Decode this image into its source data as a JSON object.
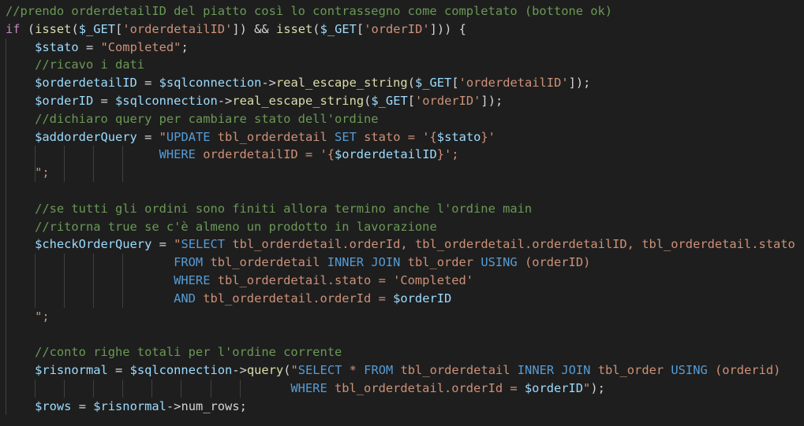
{
  "editor": {
    "language": "php",
    "theme_colors": {
      "background": "#1e1e1e",
      "comment": "#6a9955",
      "keyword": "#c586c0",
      "function": "#dcdcaa",
      "variable": "#9cdcfe",
      "string": "#ce9178",
      "sql_keyword": "#569cd6",
      "plain": "#d4d4d4"
    },
    "lines": [
      {
        "guides": 0,
        "tokens": [
          {
            "t": "comment",
            "v": "//prendo orderdetailID del piatto così lo contrassegno come completato (bottone ok)"
          }
        ]
      },
      {
        "guides": 0,
        "tokens": [
          {
            "t": "keyword",
            "v": "if"
          },
          {
            "t": "plain",
            "v": " ("
          },
          {
            "t": "func",
            "v": "isset"
          },
          {
            "t": "plain",
            "v": "("
          },
          {
            "t": "var",
            "v": "$_GET"
          },
          {
            "t": "plain",
            "v": "["
          },
          {
            "t": "string",
            "v": "'orderdetailID'"
          },
          {
            "t": "plain",
            "v": "]) && "
          },
          {
            "t": "func",
            "v": "isset"
          },
          {
            "t": "plain",
            "v": "("
          },
          {
            "t": "var",
            "v": "$_GET"
          },
          {
            "t": "plain",
            "v": "["
          },
          {
            "t": "string",
            "v": "'orderID'"
          },
          {
            "t": "plain",
            "v": "])) {"
          }
        ]
      },
      {
        "guides": 1,
        "tokens": [
          {
            "t": "plain",
            "v": "    "
          },
          {
            "t": "var",
            "v": "$stato"
          },
          {
            "t": "plain",
            "v": " = "
          },
          {
            "t": "string",
            "v": "\"Completed\""
          },
          {
            "t": "plain",
            "v": ";"
          }
        ]
      },
      {
        "guides": 1,
        "tokens": [
          {
            "t": "plain",
            "v": "    "
          },
          {
            "t": "comment",
            "v": "//ricavo i dati"
          }
        ]
      },
      {
        "guides": 1,
        "tokens": [
          {
            "t": "plain",
            "v": "    "
          },
          {
            "t": "var",
            "v": "$orderdetailID"
          },
          {
            "t": "plain",
            "v": " = "
          },
          {
            "t": "var",
            "v": "$sqlconnection"
          },
          {
            "t": "plain",
            "v": "->"
          },
          {
            "t": "func",
            "v": "real_escape_string"
          },
          {
            "t": "plain",
            "v": "("
          },
          {
            "t": "var",
            "v": "$_GET"
          },
          {
            "t": "plain",
            "v": "["
          },
          {
            "t": "string",
            "v": "'orderdetailID'"
          },
          {
            "t": "plain",
            "v": "]);"
          }
        ]
      },
      {
        "guides": 1,
        "tokens": [
          {
            "t": "plain",
            "v": "    "
          },
          {
            "t": "var",
            "v": "$orderID"
          },
          {
            "t": "plain",
            "v": " = "
          },
          {
            "t": "var",
            "v": "$sqlconnection"
          },
          {
            "t": "plain",
            "v": "->"
          },
          {
            "t": "func",
            "v": "real_escape_string"
          },
          {
            "t": "plain",
            "v": "("
          },
          {
            "t": "var",
            "v": "$_GET"
          },
          {
            "t": "plain",
            "v": "["
          },
          {
            "t": "string",
            "v": "'orderID'"
          },
          {
            "t": "plain",
            "v": "]);"
          }
        ]
      },
      {
        "guides": 1,
        "tokens": [
          {
            "t": "plain",
            "v": "    "
          },
          {
            "t": "comment",
            "v": "//dichiaro query per cambiare stato dell'ordine"
          }
        ]
      },
      {
        "guides": 1,
        "tokens": [
          {
            "t": "plain",
            "v": "    "
          },
          {
            "t": "var",
            "v": "$addorderQuery"
          },
          {
            "t": "plain",
            "v": " = "
          },
          {
            "t": "string",
            "v": "\""
          },
          {
            "t": "sqlkw",
            "v": "UPDATE"
          },
          {
            "t": "string",
            "v": " tbl_orderdetail "
          },
          {
            "t": "sqlkw",
            "v": "SET"
          },
          {
            "t": "string",
            "v": " stato = '{"
          },
          {
            "t": "var",
            "v": "$stato"
          },
          {
            "t": "string",
            "v": "}'"
          }
        ]
      },
      {
        "guides": 5,
        "tokens": [
          {
            "t": "plain",
            "v": "                     "
          },
          {
            "t": "sqlkw",
            "v": "WHERE"
          },
          {
            "t": "string",
            "v": " orderdetailID = '{"
          },
          {
            "t": "var",
            "v": "$orderdetailID"
          },
          {
            "t": "string",
            "v": "}';"
          }
        ]
      },
      {
        "guides": 5,
        "tokens": [
          {
            "t": "plain",
            "v": "    "
          },
          {
            "t": "string",
            "v": "\";"
          }
        ]
      },
      {
        "guides": 1,
        "tokens": [
          {
            "t": "plain",
            "v": ""
          }
        ]
      },
      {
        "guides": 1,
        "tokens": [
          {
            "t": "plain",
            "v": "    "
          },
          {
            "t": "comment",
            "v": "//se tutti gli ordini sono finiti allora termino anche l'ordine main"
          }
        ]
      },
      {
        "guides": 1,
        "tokens": [
          {
            "t": "plain",
            "v": "    "
          },
          {
            "t": "comment",
            "v": "//ritorna true se c'è almeno un prodotto in lavorazione"
          }
        ]
      },
      {
        "guides": 1,
        "tokens": [
          {
            "t": "plain",
            "v": "    "
          },
          {
            "t": "var",
            "v": "$checkOrderQuery"
          },
          {
            "t": "plain",
            "v": " = "
          },
          {
            "t": "string",
            "v": "\""
          },
          {
            "t": "sqlkw",
            "v": "SELECT"
          },
          {
            "t": "string",
            "v": " tbl_orderdetail.orderId, tbl_orderdetail.orderdetailID, tbl_orderdetail.stato"
          }
        ]
      },
      {
        "guides": 5,
        "tokens": [
          {
            "t": "plain",
            "v": "                       "
          },
          {
            "t": "sqlkw",
            "v": "FROM"
          },
          {
            "t": "string",
            "v": " tbl_orderdetail "
          },
          {
            "t": "sqlkw",
            "v": "INNER JOIN"
          },
          {
            "t": "string",
            "v": " tbl_order "
          },
          {
            "t": "sqlkw",
            "v": "USING"
          },
          {
            "t": "string",
            "v": " (orderID)"
          }
        ]
      },
      {
        "guides": 5,
        "tokens": [
          {
            "t": "plain",
            "v": "                       "
          },
          {
            "t": "sqlkw",
            "v": "WHERE"
          },
          {
            "t": "string",
            "v": " tbl_orderdetail.stato = 'Completed'"
          }
        ]
      },
      {
        "guides": 5,
        "tokens": [
          {
            "t": "plain",
            "v": "                       "
          },
          {
            "t": "sqlkw",
            "v": "AND"
          },
          {
            "t": "string",
            "v": " tbl_orderdetail.orderId = "
          },
          {
            "t": "var",
            "v": "$orderID"
          }
        ]
      },
      {
        "guides": 1,
        "tokens": [
          {
            "t": "plain",
            "v": "    "
          },
          {
            "t": "string",
            "v": "\";"
          }
        ]
      },
      {
        "guides": 1,
        "tokens": [
          {
            "t": "plain",
            "v": ""
          }
        ]
      },
      {
        "guides": 1,
        "tokens": [
          {
            "t": "plain",
            "v": "    "
          },
          {
            "t": "comment",
            "v": "//conto righe totali per l'ordine corrente"
          }
        ]
      },
      {
        "guides": 1,
        "tokens": [
          {
            "t": "plain",
            "v": "    "
          },
          {
            "t": "var",
            "v": "$risnormal"
          },
          {
            "t": "plain",
            "v": " = "
          },
          {
            "t": "var",
            "v": "$sqlconnection"
          },
          {
            "t": "plain",
            "v": "->"
          },
          {
            "t": "func",
            "v": "query"
          },
          {
            "t": "plain",
            "v": "("
          },
          {
            "t": "string",
            "v": "\""
          },
          {
            "t": "sqlkw",
            "v": "SELECT"
          },
          {
            "t": "string",
            "v": " * "
          },
          {
            "t": "sqlkw",
            "v": "FROM"
          },
          {
            "t": "string",
            "v": " tbl_orderdetail "
          },
          {
            "t": "sqlkw",
            "v": "INNER JOIN"
          },
          {
            "t": "string",
            "v": " tbl_order "
          },
          {
            "t": "sqlkw",
            "v": "USING"
          },
          {
            "t": "string",
            "v": " (orderid)"
          }
        ]
      },
      {
        "guides": 9,
        "tokens": [
          {
            "t": "plain",
            "v": "                                       "
          },
          {
            "t": "sqlkw",
            "v": "WHERE"
          },
          {
            "t": "string",
            "v": " tbl_orderdetail.orderId = "
          },
          {
            "t": "var",
            "v": "$orderID"
          },
          {
            "t": "string",
            "v": "\""
          },
          {
            "t": "plain",
            "v": ");"
          }
        ]
      },
      {
        "guides": 1,
        "tokens": [
          {
            "t": "plain",
            "v": "    "
          },
          {
            "t": "var",
            "v": "$rows"
          },
          {
            "t": "plain",
            "v": " = "
          },
          {
            "t": "var",
            "v": "$risnormal"
          },
          {
            "t": "plain",
            "v": "->"
          },
          {
            "t": "plain",
            "v": "num_rows;"
          }
        ]
      }
    ]
  }
}
